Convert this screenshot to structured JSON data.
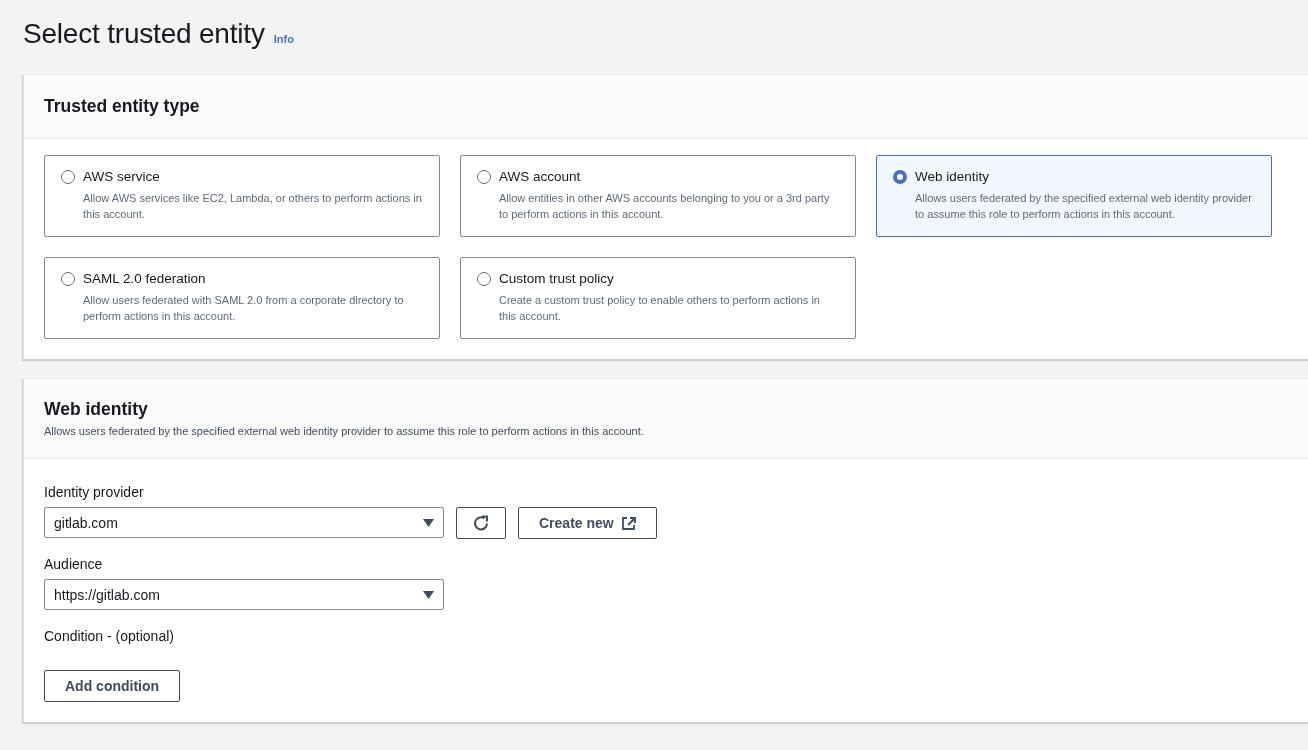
{
  "page": {
    "title": "Select trusted entity",
    "info_link": "Info"
  },
  "trusted_entity_type": {
    "heading": "Trusted entity type",
    "options": [
      {
        "title": "AWS service",
        "description": "Allow AWS services like EC2, Lambda, or others to perform actions in this account.",
        "selected": false
      },
      {
        "title": "AWS account",
        "description": "Allow entities in other AWS accounts belonging to you or a 3rd party to perform actions in this account.",
        "selected": false
      },
      {
        "title": "Web identity",
        "description": "Allows users federated by the specified external web identity provider to assume this role to perform actions in this account.",
        "selected": true
      },
      {
        "title": "SAML 2.0 federation",
        "description": "Allow users federated with SAML 2.0 from a corporate directory to perform actions in this account.",
        "selected": false
      },
      {
        "title": "Custom trust policy",
        "description": "Create a custom trust policy to enable others to perform actions in this account.",
        "selected": false
      }
    ]
  },
  "web_identity": {
    "heading": "Web identity",
    "description": "Allows users federated by the specified external web identity provider to assume this role to perform actions in this account.",
    "identity_provider": {
      "label": "Identity provider",
      "value": "gitlab.com",
      "create_new_button": "Create new"
    },
    "audience": {
      "label": "Audience",
      "value": "https://gitlab.com"
    },
    "condition": {
      "label": "Condition - (optional)",
      "button": "Add condition"
    }
  }
}
